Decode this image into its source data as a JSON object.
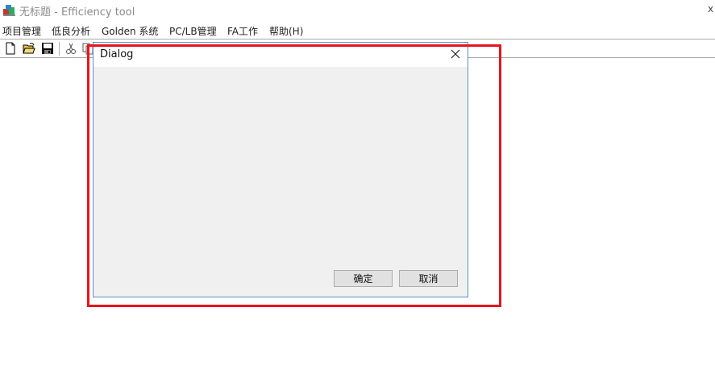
{
  "window": {
    "title": "无标题 - Efficiency tool",
    "close_glyph": "x"
  },
  "menubar": {
    "items": [
      {
        "label": "项目管理"
      },
      {
        "label": "低良分析"
      },
      {
        "label": "Golden 系统"
      },
      {
        "label": "PC/LB管理"
      },
      {
        "label": "FA工作"
      },
      {
        "label": "帮助(H)"
      }
    ]
  },
  "toolbar": {
    "icons": [
      "new-file-icon",
      "open-folder-icon",
      "save-icon",
      "cut-icon",
      "copy-icon"
    ]
  },
  "dialog": {
    "title": "Dialog",
    "ok_label": "确定",
    "cancel_label": "取消"
  },
  "colors": {
    "dialog_border": "#5b8fc9",
    "dialog_body": "#f0f0f0",
    "highlight": "#e8141a"
  }
}
